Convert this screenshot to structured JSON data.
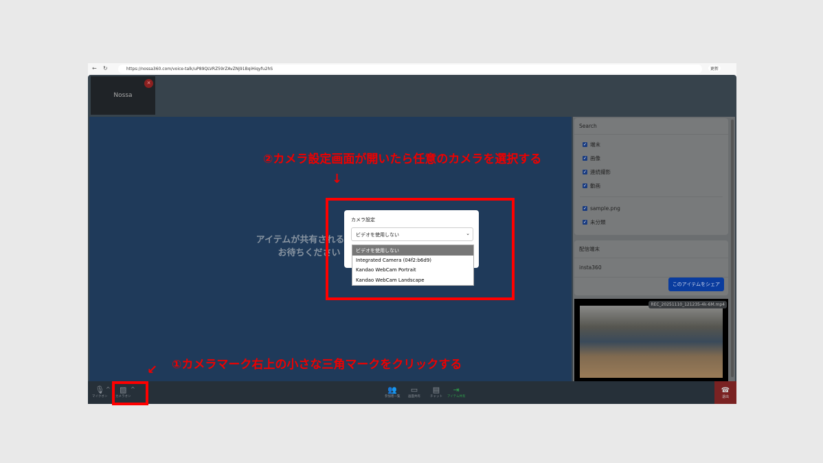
{
  "browser": {
    "url": "https://nossa360.com/voice-talk/uP89QLVRZ59rZAvZNj91BqiHiqyfu2hS",
    "update_label": "更新"
  },
  "participant": {
    "name": "Nossa"
  },
  "stage": {
    "wait_line1": "アイテムが共有されるまで",
    "wait_line2": "お待ちください"
  },
  "sidebar": {
    "search": "Search",
    "filters": [
      "端末",
      "画像",
      "連続撮影",
      "動画"
    ],
    "files": [
      "sample.png",
      "未分類"
    ],
    "device_card": {
      "title": "配信端末",
      "device": "insta360",
      "share_button": "このアイテムをシェア"
    },
    "video_label": "REC_20251110_121235-4k-6M.mp4"
  },
  "toolbar": {
    "mic": "マイクオン",
    "camera": "カメラオン",
    "participants": "参加者一覧",
    "screen_share": "画面共有",
    "chat": "チャット",
    "item_share": "アイテム共有",
    "exit": "退出"
  },
  "modal": {
    "title": "カメラ設定",
    "selected": "ビデオを使用しない",
    "options": [
      "ビデオを使用しない",
      "Integrated Camera (04f2:b6d9)",
      "Kandao WebCam Portrait",
      "Kandao WebCam Landscape"
    ]
  },
  "annotations": {
    "step1": "①カメラマーク右上の小さな三角マークをクリックする",
    "step2": "②カメラ設定画面が開いたら任意のカメラを選択する"
  }
}
